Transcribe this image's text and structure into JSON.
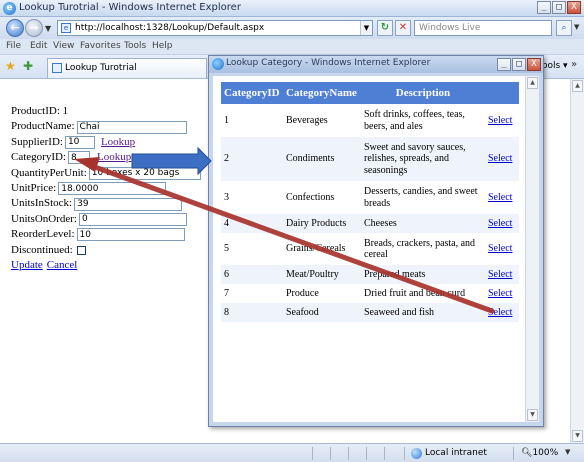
{
  "main_window": {
    "title": "Lookup Turotrial - Windows Internet Explorer",
    "url": "http://localhost:1328/Lookup/Default.aspx",
    "search_placeholder": "Windows Live",
    "menu": [
      "File",
      "Edit",
      "View",
      "Favorites",
      "Tools",
      "Help"
    ],
    "tab_label": "Lookup Turotrial",
    "tools_label": "Tools ▾",
    "status_zone": "Local intranet",
    "zoom": "100%"
  },
  "form": {
    "product_id_label": "ProductID:",
    "product_id_value": "1",
    "product_name_label": "ProductName:",
    "product_name_value": "Chai",
    "supplier_id_label": "SupplierID:",
    "supplier_id_value": "10",
    "category_id_label": "CategoryID:",
    "category_id_value": "8",
    "lookup_label": "Lookup",
    "quantity_per_unit_label": "QuantityPerUnit:",
    "quantity_per_unit_value": "10 boxes x 20 bags",
    "unit_price_label": "UnitPrice:",
    "unit_price_value": "18.0000",
    "units_in_stock_label": "UnitsInStock:",
    "units_in_stock_value": "39",
    "units_on_order_label": "UnitsOnOrder:",
    "units_on_order_value": "0",
    "reorder_level_label": "ReorderLevel:",
    "reorder_level_value": "10",
    "discontinued_label": "Discontinued:",
    "discontinued_checked": false,
    "update_label": "Update",
    "cancel_label": "Cancel"
  },
  "popup": {
    "title": "Lookup Category - Windows Internet Explorer",
    "columns": [
      "CategoryID",
      "CategoryName",
      "Description"
    ],
    "select_label": "Select",
    "rows": [
      {
        "id": "1",
        "name": "Beverages",
        "description": "Soft drinks, coffees, teas, beers, and ales"
      },
      {
        "id": "2",
        "name": "Condiments",
        "description": "Sweet and savory sauces, relishes, spreads, and seasonings"
      },
      {
        "id": "3",
        "name": "Confections",
        "description": "Desserts, candies, and sweet breads"
      },
      {
        "id": "4",
        "name": "Dairy Products",
        "description": "Cheeses"
      },
      {
        "id": "5",
        "name": "Grains/Cereals",
        "description": "Breads, crackers, pasta, and cereal"
      },
      {
        "id": "6",
        "name": "Meat/Poultry",
        "description": "Prepared meats"
      },
      {
        "id": "7",
        "name": "Produce",
        "description": "Dried fruit and bean curd"
      },
      {
        "id": "8",
        "name": "Seafood",
        "description": "Seaweed and fish"
      }
    ]
  },
  "colors": {
    "table_header": "#4f7fd4",
    "annotation_red": "#a8322c",
    "annotation_blue": "#3c6fc4"
  }
}
